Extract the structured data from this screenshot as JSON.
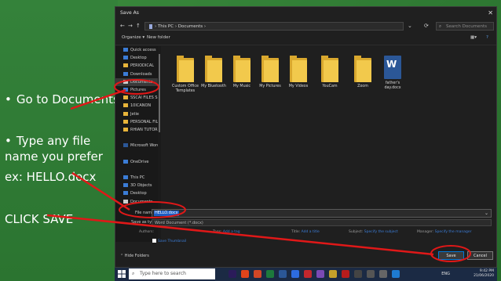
{
  "slide": {
    "instructions": [
      {
        "text": "Go to Documents",
        "bullet": true
      },
      {
        "text": "Type any file name you prefer",
        "bullet": true
      },
      {
        "text": "ex: HELLO.docx",
        "bullet": false
      },
      {
        "text": "CLICK SAVE",
        "bullet": false
      }
    ]
  },
  "dialog": {
    "title": "Save As",
    "close_glyph": "✕",
    "nav_back": "←",
    "nav_forward": "→",
    "nav_up": "↑",
    "breadcrumb": "› This PC › Documents ›",
    "search_placeholder": "Search Documents",
    "toolbar": {
      "organize": "Organize ▾",
      "new_folder": "New folder"
    },
    "nav_items": [
      {
        "label": "Quick access",
        "icon": "star-icon",
        "color": "#3b7cd6"
      },
      {
        "label": "Desktop",
        "icon": "desktop-icon",
        "color": "#3b7cd6"
      },
      {
        "label": "PERIODICAL",
        "icon": "folder-icon",
        "color": "#e8b43a"
      },
      {
        "label": "Downloads",
        "icon": "download-icon",
        "color": "#3b7cd6"
      },
      {
        "label": "Documents",
        "icon": "document-icon",
        "color": "#cfcfcf",
        "selected": true
      },
      {
        "label": "Pictures",
        "icon": "pictures-icon",
        "color": "#3b7cd6"
      },
      {
        "label": "SSCAI FILES S",
        "icon": "folder-icon",
        "color": "#e8b43a"
      },
      {
        "label": "10ICANON",
        "icon": "folder-icon",
        "color": "#e8b43a"
      },
      {
        "label": "Jetie",
        "icon": "folder-icon",
        "color": "#e8b43a"
      },
      {
        "label": "PERSONAL FILES",
        "icon": "folder-icon",
        "color": "#e8b43a"
      },
      {
        "label": "RHIAN TUTORIA",
        "icon": "folder-icon",
        "color": "#e8b43a"
      },
      {
        "label": "",
        "icon": "spacer",
        "color": "transparent"
      },
      {
        "label": "Microsoft Word",
        "icon": "word-icon",
        "color": "#2b5797"
      },
      {
        "label": "",
        "icon": "spacer",
        "color": "transparent"
      },
      {
        "label": "OneDrive",
        "icon": "cloud-icon",
        "color": "#3b7cd6"
      },
      {
        "label": "",
        "icon": "spacer",
        "color": "transparent"
      },
      {
        "label": "This PC",
        "icon": "computer-icon",
        "color": "#3b7cd6"
      },
      {
        "label": "3D Objects",
        "icon": "cube-icon",
        "color": "#3b7cd6"
      },
      {
        "label": "Desktop",
        "icon": "desktop-icon",
        "color": "#3b7cd6"
      },
      {
        "label": "Documents",
        "icon": "document-icon",
        "color": "#cfcfcf"
      }
    ],
    "files": [
      {
        "name": "Custom Office Templates",
        "kind": "folder"
      },
      {
        "name": "My Bluetooth",
        "kind": "folder"
      },
      {
        "name": "My Music",
        "kind": "folder"
      },
      {
        "name": "My Pictures",
        "kind": "folder"
      },
      {
        "name": "My Videos",
        "kind": "folder"
      },
      {
        "name": "YouCam",
        "kind": "folder"
      },
      {
        "name": "Zoom",
        "kind": "folder"
      },
      {
        "name": "father's day.docx",
        "kind": "word"
      }
    ],
    "file_name_label": "File name:",
    "file_name_value": "HELLO.docx",
    "save_type_label": "Save as type:",
    "save_type_value": "Word Document (*.docx)",
    "meta": {
      "authors_label": "Authors:",
      "authors_value": "",
      "tags_label": "Tags:",
      "tags_value": "Add a tag",
      "title_label": "Title:",
      "title_value": "Add a title",
      "subject_label": "Subject:",
      "subject_value": "Specify the subject",
      "manager_label": "Manager:",
      "manager_value": "Specify the manager"
    },
    "save_thumbnail": "Save Thumbnail",
    "hide_folders": "⌃ Hide Folders",
    "save_button": "Save",
    "cancel_button": "Cancel"
  },
  "taskbar": {
    "search_placeholder": "Type here to search",
    "tray_lang": "ENG",
    "time": "9:42 PM",
    "date": "21/06/2020"
  },
  "colors": {
    "accent": "#0078d7",
    "annotation": "#e01818"
  }
}
